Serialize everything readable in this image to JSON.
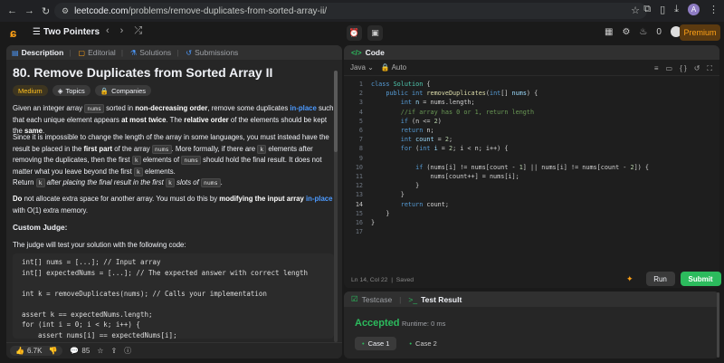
{
  "browser": {
    "url_domain": "leetcode.com",
    "url_path": "/problems/remove-duplicates-from-sorted-array-ii/",
    "avatar_letter": "A"
  },
  "lcnav": {
    "list_title": "Two Pointers",
    "streak_count": "0",
    "premium_label": "Premium"
  },
  "left_tabs": [
    {
      "label": "Description"
    },
    {
      "label": "Editorial"
    },
    {
      "label": "Solutions"
    },
    {
      "label": "Submissions"
    }
  ],
  "problem": {
    "title": "80. Remove Duplicates from Sorted Array II",
    "difficulty": "Medium",
    "topics_label": "Topics",
    "companies_label": "Companies",
    "custom_judge_heading": "Custom Judge:",
    "judge_text": "The judge will test your solution with the following code:",
    "judge_code": "int[] nums = [...]; // Input array\nint[] expectedNums = [...]; // The expected answer with correct length\n\nint k = removeDuplicates(nums); // Calls your implementation\n\nassert k == expectedNums.length;\nfor (int i = 0; i < k; i++) {\n    assert nums[i] == expectedNums[i];\n}"
  },
  "bottom_stats": {
    "likes": "6.7K",
    "comments": "85"
  },
  "code_panel": {
    "title": "Code",
    "language": "Java",
    "auto_label": "Auto",
    "status": "Ln 14, Col 22",
    "saved": "Saved",
    "line_count": 17
  },
  "actions": {
    "run": "Run",
    "submit": "Submit"
  },
  "test_panel": {
    "testcase_tab": "Testcase",
    "result_tab": "Test Result",
    "verdict": "Accepted",
    "runtime": "Runtime: 0 ms",
    "cases": [
      "Case 1",
      "Case 2"
    ]
  },
  "colors": {
    "accent_orange": "#ffa116",
    "success_green": "#2cbb5d",
    "link_blue": "#4c9aff"
  }
}
